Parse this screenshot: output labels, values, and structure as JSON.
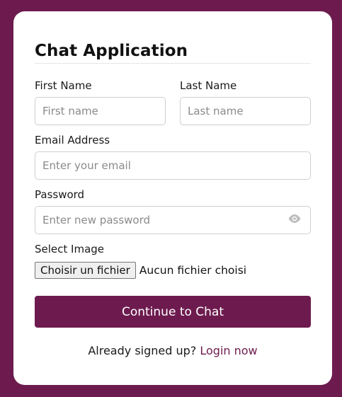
{
  "header": {
    "title": "Chat Application"
  },
  "form": {
    "first_name": {
      "label": "First Name",
      "placeholder": "First name"
    },
    "last_name": {
      "label": "Last Name",
      "placeholder": "Last name"
    },
    "email": {
      "label": "Email Address",
      "placeholder": "Enter your email"
    },
    "password": {
      "label": "Password",
      "placeholder": "Enter new password",
      "toggle_icon": "eye-icon"
    },
    "image": {
      "label": "Select Image",
      "button_label": "Choisir un fichier",
      "status_text": "Aucun fichier choisi"
    },
    "submit_label": "Continue to Chat"
  },
  "footer": {
    "text": "Already signed up?",
    "link_label": "Login now"
  },
  "colors": {
    "brand": "#6d1b4f",
    "background": "#6d1b4f",
    "card": "#ffffff"
  }
}
